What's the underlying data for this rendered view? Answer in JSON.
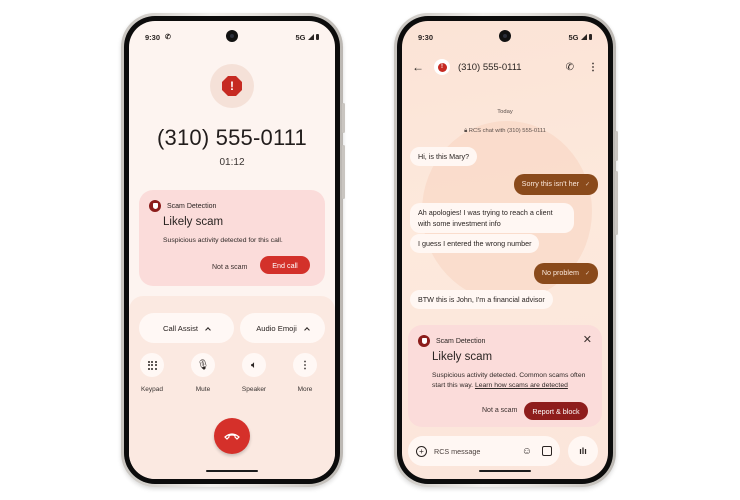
{
  "left_phone": {
    "status_bar": {
      "time": "9:30",
      "call_icon": "phone-call-icon",
      "network": "5G"
    },
    "alert_icon": "alert-octagon-icon",
    "caller_number": "(310) 555-0111",
    "call_duration": "01:12",
    "scam_card": {
      "header": "Scam Detection",
      "title": "Likely scam",
      "description": "Suspicious activity detected for this call.",
      "not_scam_label": "Not a scam",
      "end_call_label": "End call"
    },
    "chips": [
      {
        "label": "Call Assist",
        "icon": "chevron-up-icon"
      },
      {
        "label": "Audio Emoji",
        "icon": "chevron-up-icon"
      }
    ],
    "controls": [
      {
        "label": "Keypad",
        "icon": "keypad-icon"
      },
      {
        "label": "Mute",
        "icon": "mic-off-icon"
      },
      {
        "label": "Speaker",
        "icon": "speaker-icon"
      },
      {
        "label": "More",
        "icon": "more-vert-icon"
      }
    ],
    "end_call_icon": "hang-up-icon",
    "colors": {
      "end_call": "#d5302a",
      "scam_card_bg": "#fbdcda"
    }
  },
  "right_phone": {
    "status_bar": {
      "time": "9:30",
      "network": "5G"
    },
    "header": {
      "contact": "(310) 555-0111"
    },
    "date_separator": "Today",
    "rcs_info": "RCS chat with (310) 555-0111",
    "messages": [
      {
        "direction": "in",
        "text": "Hi, is this Mary?"
      },
      {
        "direction": "out",
        "text": "Sorry this isn't her",
        "status": "✓"
      },
      {
        "direction": "in",
        "text": "Ah apologies! I was trying to reach a client with some investment info"
      },
      {
        "direction": "in",
        "text": "I guess I entered the wrong number"
      },
      {
        "direction": "out",
        "text": "No problem",
        "status": "✓"
      },
      {
        "direction": "in",
        "text": "BTW this is John, I'm a financial advisor"
      }
    ],
    "scam_card": {
      "header": "Scam Detection",
      "title": "Likely scam",
      "description": "Suspicious activity detected. Common scams often start this way.",
      "link": "Learn how scams are detected",
      "not_scam_label": "Not a scam",
      "report_label": "Report & block"
    },
    "composer": {
      "placeholder": "RCS message"
    },
    "colors": {
      "outgoing_bubble": "#8a4a1b",
      "report_button": "#8e1d1c"
    }
  }
}
